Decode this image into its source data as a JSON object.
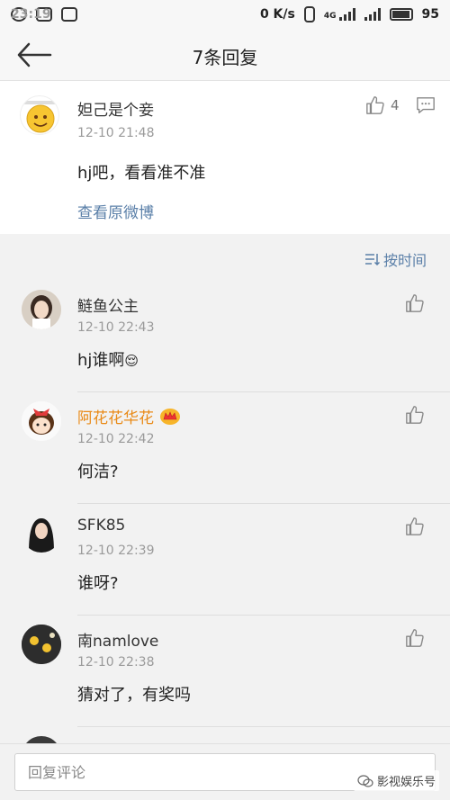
{
  "status_bar": {
    "time": "23:19",
    "speed": "0 K/s",
    "network": "4G",
    "battery": "95"
  },
  "nav": {
    "title": "7条回复"
  },
  "root_comment": {
    "user": "妲己是个妾",
    "time": "12-10 21:48",
    "text": "hj吧，看看准不准",
    "link": "查看原微博",
    "likes": "4"
  },
  "sort": {
    "label": "按时间"
  },
  "replies": [
    {
      "user": "鲢鱼公主",
      "time": "12-10 22:43",
      "text": "hj谁啊",
      "emoji": "😌",
      "name_color": "#333333"
    },
    {
      "user": "阿花花华花",
      "time": "12-10 22:42",
      "text": "何洁?",
      "emoji": "",
      "name_color": "#e98a17"
    },
    {
      "user": "SFK85",
      "time": "12-10 22:39",
      "text": "谁呀?",
      "emoji": "",
      "name_color": "#333333"
    },
    {
      "user": "南namlove",
      "time": "12-10 22:38",
      "text": "猜对了，有奖吗",
      "emoji": "",
      "name_color": "#333333"
    }
  ],
  "bottom": {
    "placeholder": "回复评论",
    "watermark": "影视娱乐号"
  },
  "icons": [
    "back-arrow-icon",
    "thumbs-up-icon",
    "comment-icon",
    "sort-icon",
    "crown-badge-icon",
    "wechat-icon"
  ]
}
